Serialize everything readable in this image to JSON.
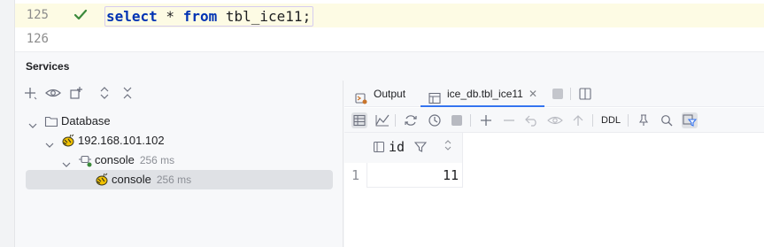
{
  "editor": {
    "lines": [
      {
        "number": "125",
        "status": "check-icon",
        "tokens": [
          {
            "text": "select",
            "kind": "keyword"
          },
          {
            "text": " * ",
            "kind": "plain"
          },
          {
            "text": "from",
            "kind": "keyword"
          },
          {
            "text": " tbl_ice11",
            "kind": "plain"
          },
          {
            "text": ";",
            "kind": "plain"
          }
        ]
      },
      {
        "number": "126"
      }
    ]
  },
  "services": {
    "title": "Services",
    "toolbar": [
      "add-icon",
      "eye-icon",
      "new-group-icon",
      "expand-all-icon",
      "collapse-all-icon"
    ],
    "tree": [
      {
        "label": "Database",
        "icon": "folder-icon",
        "expanded": true
      },
      {
        "label": "192.168.101.102",
        "icon": "hive-db-icon",
        "expanded": true
      },
      {
        "label": "console",
        "meta": "256 ms",
        "icon": "console-connection-icon",
        "expanded": true
      },
      {
        "label": "console",
        "meta": "256 ms",
        "icon": "hive-db-icon",
        "selected": true
      }
    ]
  },
  "results": {
    "tabs": [
      {
        "label": "Output",
        "icon": "output-icon"
      },
      {
        "label": "ice_db.tbl_ice11",
        "icon": "table-icon",
        "active": true
      }
    ],
    "toolbar_ddl": "DDL",
    "columns": [
      {
        "name": "id"
      }
    ],
    "rows": [
      {
        "num": "1",
        "values": [
          "11"
        ]
      }
    ]
  },
  "colors": {
    "keyword": "#0033b3",
    "accent": "#3574f0",
    "check": "#3b8a3b",
    "current_line": "#fdfbe4"
  }
}
